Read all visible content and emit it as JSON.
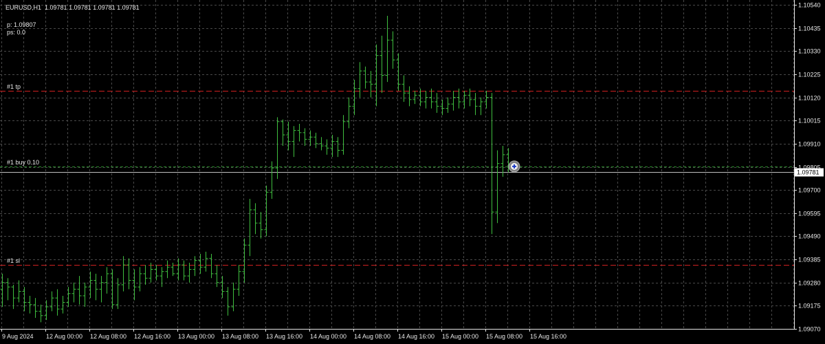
{
  "header": {
    "symbol_tf": "EURUSD,H1",
    "ohlc": "1.09781 1.09781 1.09781 1.09781"
  },
  "info": {
    "p": "p: 1.09807",
    "ps": "ps: 0.0"
  },
  "levels": {
    "tp": {
      "label": "#1 tp",
      "price": 1.1015
    },
    "buy": {
      "label": "#1 buy 0.10",
      "price": 1.09807
    },
    "sl": {
      "label": "#1 sl",
      "price": 1.0936
    }
  },
  "current_price": {
    "label": "1.09781",
    "price": 1.09781
  },
  "colors": {
    "background": "#000000",
    "grid": "#4a4a4a",
    "candle": "#3fbf3f",
    "tp_line": "#d02020",
    "sl_line": "#d02020",
    "buy_line": "#2a8a2a",
    "price_line": "#c0c0c0",
    "axis_text": "#e8e8e8",
    "current_label_bg": "#ffffff",
    "current_label_text": "#000000"
  },
  "chart_data": {
    "type": "ohlc",
    "symbol": "EURUSD",
    "timeframe": "H1",
    "price_axis_ticks": [
      "1.10540",
      "1.10435",
      "1.10330",
      "1.10225",
      "1.10120",
      "1.10015",
      "1.09910",
      "1.09805",
      "1.09700",
      "1.09595",
      "1.09490",
      "1.09385",
      "1.09280",
      "1.09175",
      "1.09070"
    ],
    "time_axis_ticks": [
      "9 Aug 2024",
      "12 Aug 00:00",
      "12 Aug 08:00",
      "12 Aug 16:00",
      "13 Aug 00:00",
      "13 Aug 08:00",
      "13 Aug 16:00",
      "14 Aug 00:00",
      "14 Aug 08:00",
      "14 Aug 16:00",
      "15 Aug 00:00",
      "15 Aug 08:00",
      "15 Aug 16:00"
    ],
    "ylim": [
      1.09055,
      1.10555
    ],
    "grid": true,
    "bars": [
      [
        1.0925,
        1.0932,
        1.0917,
        1.0928
      ],
      [
        1.0928,
        1.093,
        1.092,
        1.0926
      ],
      [
        1.0926,
        1.0927,
        1.0916,
        1.0921
      ],
      [
        1.0921,
        1.0929,
        1.0919,
        1.0924
      ],
      [
        1.0924,
        1.0926,
        1.0915,
        1.0919
      ],
      [
        1.0919,
        1.0922,
        1.0914,
        1.0918
      ],
      [
        1.0918,
        1.0921,
        1.0912,
        1.0915
      ],
      [
        1.0915,
        1.0918,
        1.091,
        1.0913
      ],
      [
        1.0913,
        1.092,
        1.0911,
        1.0917
      ],
      [
        1.0917,
        1.0924,
        1.0915,
        1.0921
      ],
      [
        1.0921,
        1.0925,
        1.0913,
        1.0916
      ],
      [
        1.0916,
        1.0922,
        1.0914,
        1.0919
      ],
      [
        1.0919,
        1.0926,
        1.0917,
        1.0923
      ],
      [
        1.0923,
        1.0928,
        1.0919,
        1.0925
      ],
      [
        1.0925,
        1.0931,
        1.0918,
        1.0922
      ],
      [
        1.0922,
        1.0928,
        1.0917,
        1.0926
      ],
      [
        1.0926,
        1.0933,
        1.0921,
        1.0929
      ],
      [
        1.0929,
        1.0932,
        1.092,
        1.0925
      ],
      [
        1.0925,
        1.0931,
        1.0919,
        1.0928
      ],
      [
        1.0928,
        1.0935,
        1.0923,
        1.0932
      ],
      [
        1.0932,
        1.0934,
        1.0916,
        1.0918
      ],
      [
        1.0918,
        1.093,
        1.0916,
        1.0927
      ],
      [
        1.0927,
        1.094,
        1.0924,
        1.0936
      ],
      [
        1.0936,
        1.0939,
        1.0925,
        1.0929
      ],
      [
        1.0929,
        1.0934,
        1.092,
        1.0926
      ],
      [
        1.0926,
        1.0935,
        1.0924,
        1.0932
      ],
      [
        1.0932,
        1.0936,
        1.0927,
        1.093
      ],
      [
        1.093,
        1.0937,
        1.0928,
        1.0934
      ],
      [
        1.0934,
        1.0936,
        1.0929,
        1.0931
      ],
      [
        1.0931,
        1.0935,
        1.0926,
        1.0933
      ],
      [
        1.0933,
        1.0938,
        1.093,
        1.0935
      ],
      [
        1.0935,
        1.0937,
        1.0931,
        1.0932
      ],
      [
        1.0932,
        1.0939,
        1.0929,
        1.0936
      ],
      [
        1.0936,
        1.0938,
        1.0929,
        1.0931
      ],
      [
        1.0931,
        1.0937,
        1.0928,
        1.0934
      ],
      [
        1.0934,
        1.094,
        1.0931,
        1.0938
      ],
      [
        1.0938,
        1.0941,
        1.0932,
        1.0935
      ],
      [
        1.0935,
        1.0942,
        1.0933,
        1.0939
      ],
      [
        1.0939,
        1.0941,
        1.093,
        1.0932
      ],
      [
        1.0932,
        1.0936,
        1.0926,
        1.0928
      ],
      [
        1.0928,
        1.0931,
        1.0921,
        1.0924
      ],
      [
        1.0924,
        1.0926,
        1.0913,
        1.0917
      ],
      [
        1.0917,
        1.0928,
        1.0915,
        1.0925
      ],
      [
        1.0925,
        1.0936,
        1.0922,
        1.0933
      ],
      [
        1.0933,
        1.0948,
        1.0928,
        1.0945
      ],
      [
        1.0945,
        1.0966,
        1.094,
        1.0961
      ],
      [
        1.0961,
        1.0964,
        1.095,
        1.0955
      ],
      [
        1.0955,
        1.096,
        1.0948,
        1.0952
      ],
      [
        1.0952,
        1.0972,
        1.0949,
        1.0969
      ],
      [
        1.0969,
        1.0983,
        1.0966,
        1.098
      ],
      [
        1.098,
        1.1003,
        1.0975,
        1.1001
      ],
      [
        1.1001,
        1.1002,
        1.099,
        1.0995
      ],
      [
        1.0995,
        1.1001,
        1.0988,
        1.0992
      ],
      [
        1.0992,
        1.0999,
        1.0985,
        1.0997
      ],
      [
        1.0997,
        1.1,
        1.0992,
        1.0996
      ],
      [
        1.0996,
        1.0998,
        1.099,
        1.0993
      ],
      [
        1.0993,
        1.0997,
        1.099,
        1.0994
      ],
      [
        1.0994,
        1.0996,
        1.0989,
        1.0991
      ],
      [
        1.0991,
        1.0994,
        1.0988,
        1.099
      ],
      [
        1.099,
        1.0993,
        1.0986,
        1.0989
      ],
      [
        1.0989,
        1.0995,
        1.0985,
        1.0992
      ],
      [
        1.0992,
        1.0994,
        1.0985,
        1.0988
      ],
      [
        1.0988,
        1.1004,
        1.0986,
        1.1001
      ],
      [
        1.1001,
        1.1012,
        1.0998,
        1.1008
      ],
      [
        1.1008,
        1.102,
        1.1004,
        1.1016
      ],
      [
        1.1016,
        1.1028,
        1.1012,
        1.1024
      ],
      [
        1.1024,
        1.1026,
        1.1016,
        1.1019
      ],
      [
        1.1019,
        1.1024,
        1.1012,
        1.1018
      ],
      [
        1.1018,
        1.1036,
        1.1008,
        1.1031
      ],
      [
        1.1031,
        1.104,
        1.1014,
        1.1022
      ],
      [
        1.1022,
        1.1049,
        1.1019,
        1.1038
      ],
      [
        1.1038,
        1.1042,
        1.1025,
        1.1029
      ],
      [
        1.1029,
        1.1032,
        1.1015,
        1.1018
      ],
      [
        1.1018,
        1.1022,
        1.101,
        1.1014
      ],
      [
        1.1014,
        1.1017,
        1.1008,
        1.1011
      ],
      [
        1.1011,
        1.1015,
        1.1009,
        1.1013
      ],
      [
        1.1013,
        1.1016,
        1.1008,
        1.101
      ],
      [
        1.101,
        1.1015,
        1.1007,
        1.1012
      ],
      [
        1.1012,
        1.1016,
        1.1007,
        1.101
      ],
      [
        1.101,
        1.1014,
        1.1005,
        1.1008
      ],
      [
        1.1008,
        1.1011,
        1.1004,
        1.1007
      ],
      [
        1.1007,
        1.1012,
        1.1005,
        1.1009
      ],
      [
        1.1009,
        1.1015,
        1.1006,
        1.1012
      ],
      [
        1.1012,
        1.1016,
        1.1007,
        1.101
      ],
      [
        1.101,
        1.1015,
        1.1007,
        1.1013
      ],
      [
        1.1013,
        1.1016,
        1.1008,
        1.1011
      ],
      [
        1.1011,
        1.1014,
        1.1004,
        1.1008
      ],
      [
        1.1008,
        1.1012,
        1.1004,
        1.101
      ],
      [
        1.101,
        1.1015,
        1.1007,
        1.1012
      ],
      [
        1.1012,
        1.1014,
        1.095,
        1.096
      ],
      [
        1.096,
        1.0988,
        1.0955,
        1.0982
      ],
      [
        1.0982,
        1.099,
        1.0976,
        1.0986
      ],
      [
        1.0986,
        1.0989,
        1.0978,
        1.0981
      ]
    ]
  }
}
